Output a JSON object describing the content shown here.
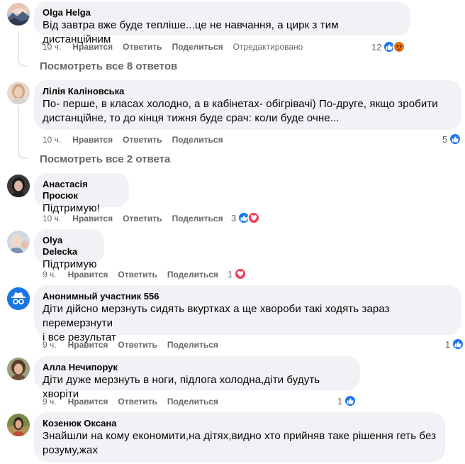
{
  "comments": [
    {
      "author": "Olga Helga",
      "text": "Від завтра вже буде тепліше...це не навчання, а цирк з тим дистанційним",
      "time": "10 ч.",
      "like": "Нравится",
      "reply": "Ответить",
      "share": "Поделиться",
      "edited": "Отредактировано",
      "reaction_count": "12",
      "reactions": [
        "like",
        "angry"
      ],
      "avatar_icon": "landscape-avatar"
    },
    {
      "author": "Лілія Каліновська",
      "text_lines": [
        "По- перше, в класах холодно, а в кабінетах- обігрівачі) По-друге, якщо зробити",
        "дистанційне, то до кінця тижня буде срач: коли буде очне..."
      ],
      "time": "10 ч.",
      "like": "Нравится",
      "reply": "Ответить",
      "share": "Поделиться",
      "reaction_count": "5",
      "reactions": [
        "like"
      ]
    },
    {
      "author": "Анастасія Просюк",
      "text": "Підтримую!",
      "time": "10 ч.",
      "like": "Нравится",
      "reply": "Ответить",
      "share": "Поделиться",
      "reaction_count": "3",
      "reactions": [
        "like",
        "love"
      ]
    },
    {
      "author": "Olya Delecka",
      "text": "Підтримую",
      "time": "9 ч.",
      "like": "Нравится",
      "reply": "Ответить",
      "share": "Поделиться",
      "reaction_count": "1",
      "reactions": [
        "love"
      ]
    },
    {
      "author": "Анонимный участник 556",
      "text_lines": [
        "Діти дійсно мерзнуть сидять вкуртках а ще хвороби такі ходять зараз перемерзнути",
        "і все результат"
      ],
      "time": "9 ч.",
      "like": "Нравится",
      "reply": "Ответить",
      "share": "Поделиться",
      "reaction_count": "1",
      "reactions": [
        "like"
      ],
      "avatar_icon": "anonymous-avatar"
    },
    {
      "author": "Алла Нечипорук",
      "text": "Діти дуже мерзнуть в ноги, підлога холодна,діти будуть хворіти",
      "time": "9 ч.",
      "like": "Нравится",
      "reply": "Ответить",
      "share": "Поделиться",
      "reaction_count": "1",
      "reactions": [
        "like"
      ]
    },
    {
      "author": "Козенюк Оксана",
      "text_lines": [
        "Знайшли на кому економити,на дітях,видно хто прийняв таке рішення геть без",
        "розуму,жах"
      ]
    }
  ],
  "view_replies": [
    "Посмотреть все 8 ответов",
    "Посмотреть все 2 ответа"
  ],
  "colors": {
    "bubble": "#f0f2f5",
    "meta": "#65676b",
    "like": "#1877f2",
    "love": "#f33e58",
    "angry": "#e9710f"
  }
}
